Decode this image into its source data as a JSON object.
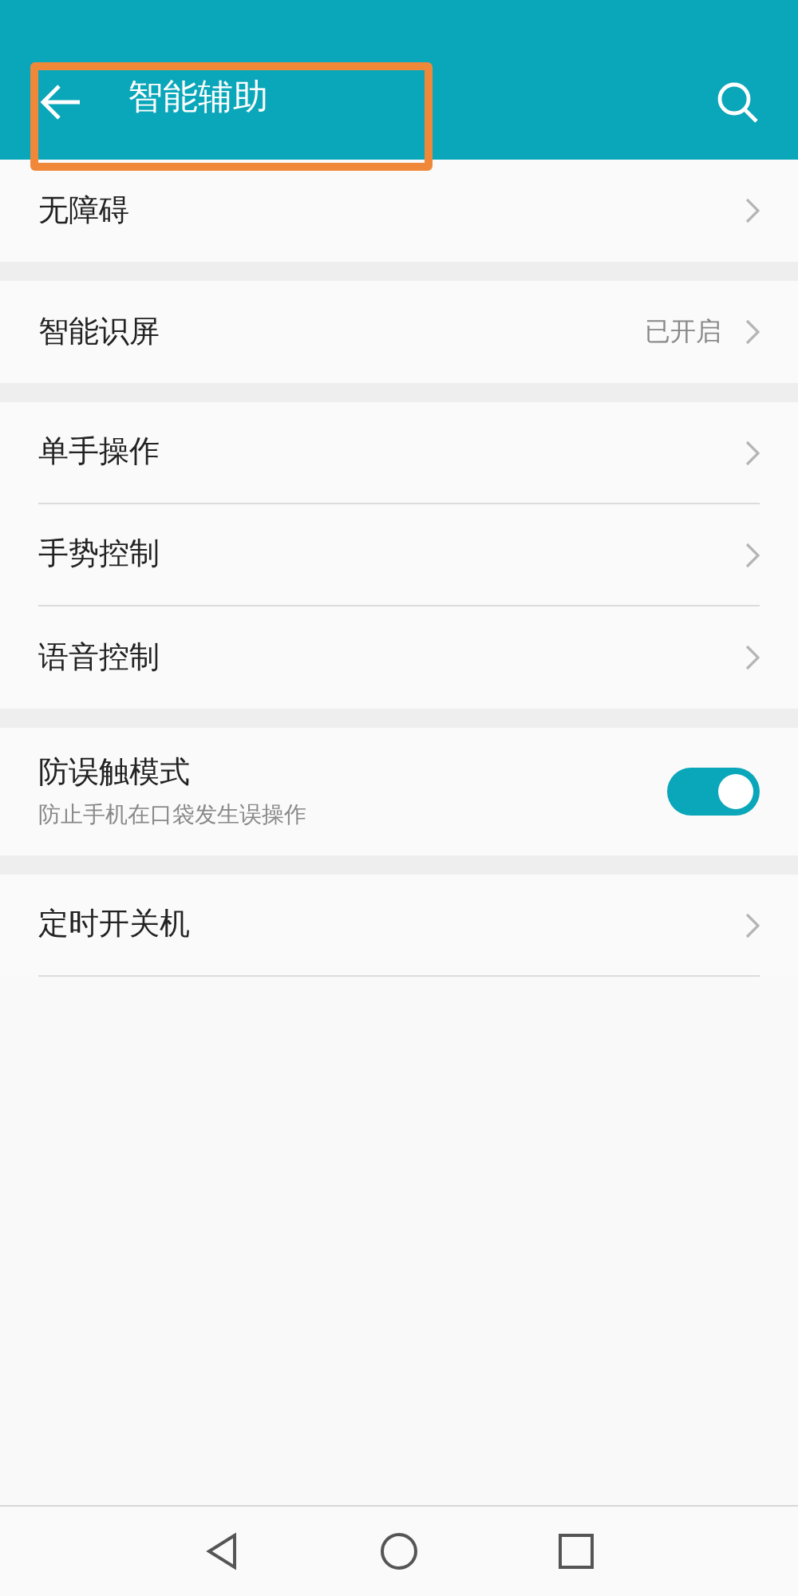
{
  "header": {
    "title": "智能辅助",
    "highlighted": true
  },
  "sections": [
    [
      {
        "kind": "link",
        "label": "无障碍"
      }
    ],
    [
      {
        "kind": "link",
        "label": "智能识屏",
        "value": "已开启"
      }
    ],
    [
      {
        "kind": "link",
        "label": "单手操作"
      },
      {
        "kind": "link",
        "label": "手势控制"
      },
      {
        "kind": "link",
        "label": "语音控制"
      }
    ],
    [
      {
        "kind": "toggle",
        "label": "防误触模式",
        "subtitle": "防止手机在口袋发生误操作",
        "on": true
      }
    ],
    [
      {
        "kind": "link",
        "label": "定时开关机"
      }
    ]
  ]
}
